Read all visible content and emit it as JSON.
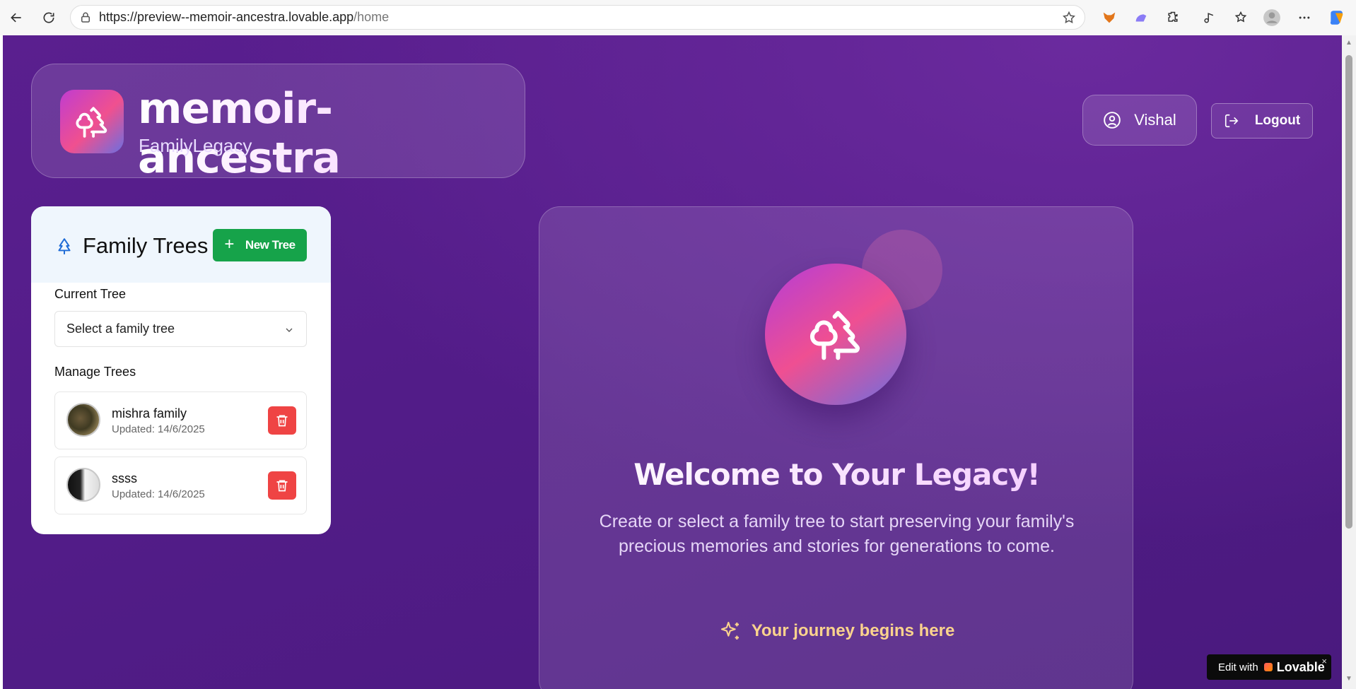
{
  "browser": {
    "url_host": "https://preview--memoir-ancestra.lovable.app",
    "url_path": "/home"
  },
  "brand": {
    "title": "memoir-ancestra",
    "subtitle": "FamilyLegacy",
    "logo_icon": "trees-icon"
  },
  "header": {
    "user_name": "Vishal",
    "logout_label": "Logout"
  },
  "trees_panel": {
    "title": "Family Trees",
    "new_tree_label": "New Tree",
    "current_tree_label": "Current Tree",
    "select_placeholder": "Select a family tree",
    "manage_label": "Manage Trees",
    "items": [
      {
        "name": "mishra family",
        "updated": "Updated: 14/6/2025"
      },
      {
        "name": "ssss",
        "updated": "Updated: 14/6/2025"
      }
    ]
  },
  "welcome": {
    "title": "Welcome to Your Legacy!",
    "text": "Create or select a family tree to start preserving your family's precious memories and stories for generations to come.",
    "journey": "Your journey begins here"
  },
  "badge": {
    "prefix": "Edit with",
    "brand": "Lovable",
    "close": "×"
  },
  "colors": {
    "accent_green": "#16a34a",
    "danger_red": "#ef4444",
    "page_purple": "#521c88",
    "journey_gold": "#fbd38d"
  }
}
